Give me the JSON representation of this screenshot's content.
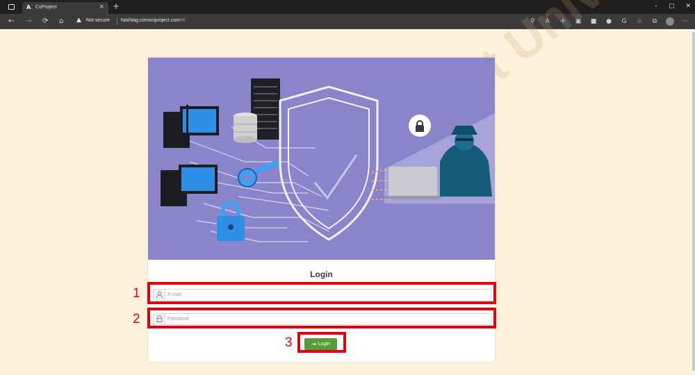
{
  "browser": {
    "tab_title": "CsProject",
    "tab_favicon": "A",
    "tab_close": "×",
    "new_tab": "+",
    "not_secure": "Not secure",
    "url": "hashtag.comsciproject.com",
    "url_suffix": "/#/",
    "window_controls": [
      "–",
      "▢",
      "✕"
    ],
    "nav": {
      "back": "←",
      "forward": "→",
      "reload": "⟳",
      "home": "⌂"
    },
    "toolbar_icons": [
      "search-icon",
      "read-aloud-icon",
      "extension-icon",
      "puzzle-icon",
      "bookmark-icon",
      "shield-icon",
      "refresh-icon",
      "favorites-icon",
      "collections-icon",
      "profile-icon",
      "more-icon"
    ]
  },
  "login": {
    "title": "Login",
    "email_placeholder": "E-mail",
    "password_placeholder": "Password",
    "button_label": "Login"
  },
  "annotations": [
    "1",
    "2",
    "3"
  ],
  "watermark": "Department University",
  "colors": {
    "page_bg": "#fdf3dc",
    "hero_bg": "#8a84cb",
    "button": "#5a9a3c",
    "annotation": "#e2000a"
  }
}
